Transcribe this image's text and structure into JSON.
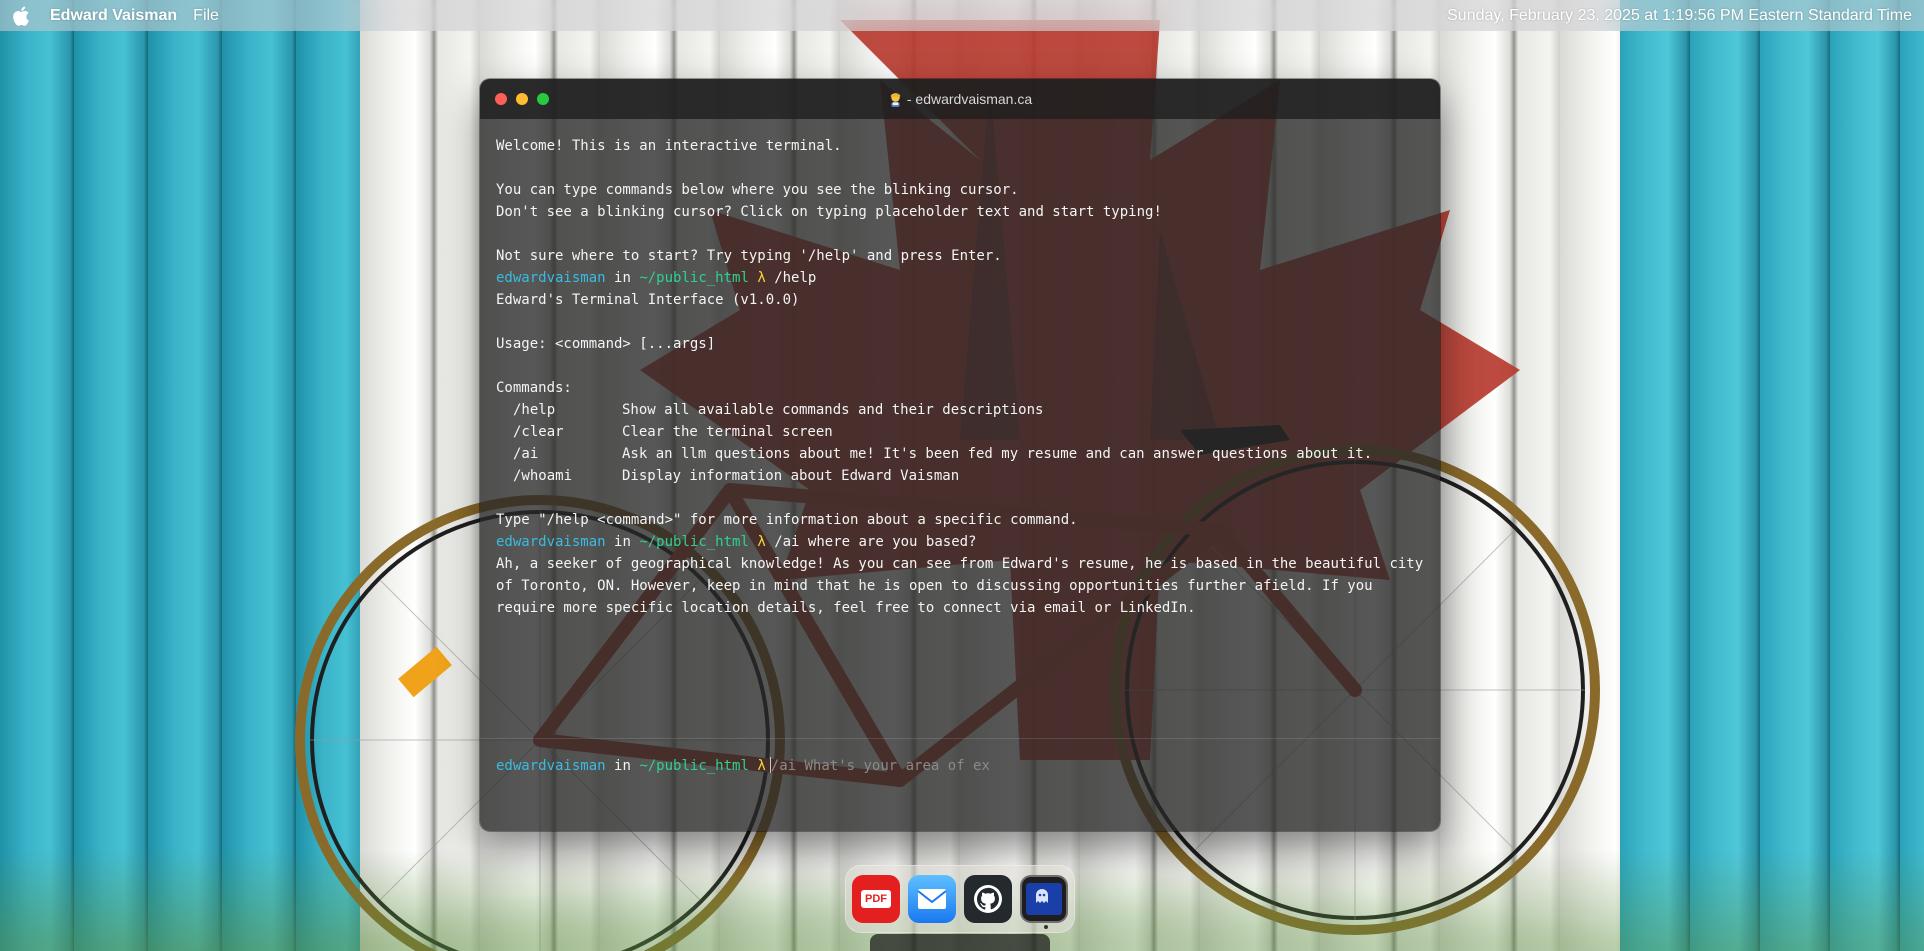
{
  "menubar": {
    "app_name": "Edward Vaisman",
    "menu_file": "File",
    "clock": "Sunday, February 23, 2025 at 1:19:56 PM Eastern Standard Time"
  },
  "terminal": {
    "title": "- edwardvaisman.ca",
    "title_icon": "person-emoji-icon",
    "prompt": {
      "user": "edwardvaisman",
      "in": "in",
      "path": "~/public_html",
      "lambda": "λ"
    },
    "welcome": [
      "Welcome! This is an interactive terminal.",
      "",
      "You can type commands below where you see the blinking cursor.",
      "Don't see a blinking cursor? Click on typing placeholder text and start typing!",
      "",
      "Not sure where to start? Try typing '/help' and press Enter."
    ],
    "history_1_cmd": " /help",
    "help_header": "Edward's Terminal Interface (v1.0.0)",
    "usage": "Usage: <command> [...args]",
    "commands_label": "Commands:",
    "commands": [
      {
        "name": "/help",
        "desc": "Show all available commands and their descriptions"
      },
      {
        "name": "/clear",
        "desc": "Clear the terminal screen"
      },
      {
        "name": "/ai",
        "desc": "Ask an llm questions about me! It's been fed my resume and can answer questions about it."
      },
      {
        "name": "/whoami",
        "desc": "Display information about Edward Vaisman"
      }
    ],
    "help_footer": "Type \"/help <command>\" for more information about a specific command.",
    "history_2_cmd": " /ai where are you based?",
    "ai_answer": [
      "Ah, a seeker of geographical knowledge! As you can see from Edward's resume, he is based in the beautiful city",
      "of Toronto, ON. However, keep in mind that he is open to discussing opportunities further afield. If you",
      "require more specific location details, feel free to connect via email or LinkedIn."
    ],
    "input_placeholder": "/ai What's your area of ex"
  },
  "dock": {
    "items": [
      {
        "name": "pdf-icon",
        "label": "PDF"
      },
      {
        "name": "mail-icon"
      },
      {
        "name": "github-icon"
      },
      {
        "name": "terminal-app-icon"
      }
    ]
  },
  "colors": {
    "prompt_user": "#38bde0",
    "prompt_path": "#2fd191",
    "prompt_lambda": "#f3d43a",
    "terminal_bg": "#282828"
  }
}
